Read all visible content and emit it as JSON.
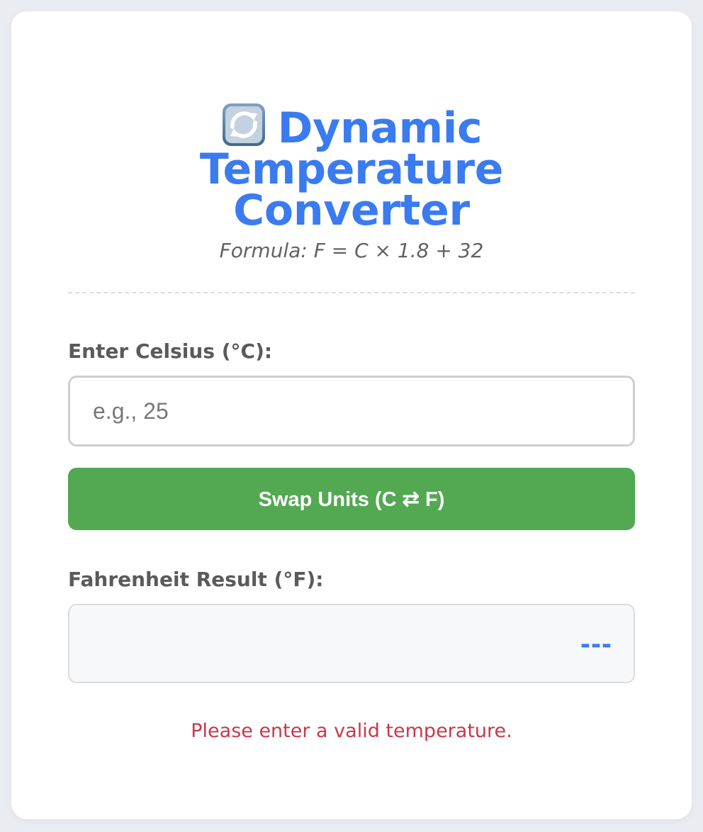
{
  "header": {
    "icon": "refresh-arrows-icon",
    "title_line1": "Dynamic Temperature",
    "title_line2": "Converter",
    "formula": "Formula: F = C × 1.8 + 32"
  },
  "celsius": {
    "label": "Enter Celsius (°C):",
    "value": "",
    "placeholder": "e.g., 25"
  },
  "swap_button": {
    "label": "Swap Units (C ⇄ F)"
  },
  "fahrenheit": {
    "label": "Fahrenheit Result (°F):",
    "value": "---"
  },
  "error": {
    "message": "Please enter a valid temperature."
  },
  "colors": {
    "accent": "#3b7bf0",
    "button": "#53a852",
    "error": "#c8384a",
    "background": "#e9edf1"
  }
}
